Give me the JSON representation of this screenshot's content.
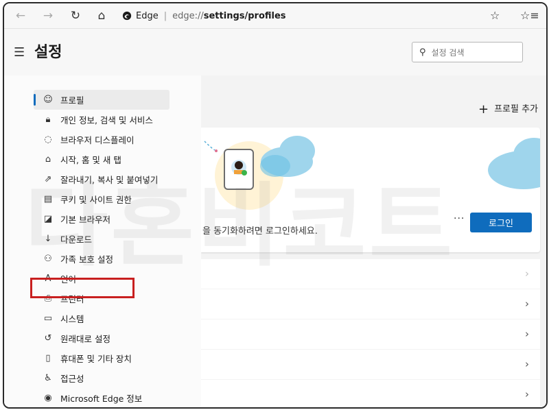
{
  "browser": {
    "brand": "Edge",
    "url_scheme": "edge://",
    "url_path": "settings/profiles"
  },
  "settings": {
    "title": "설정",
    "search_placeholder": "설정 검색"
  },
  "sidebar": {
    "items": [
      {
        "label": "프로필",
        "icon": "profile-icon",
        "glyph": "☺",
        "active": true
      },
      {
        "label": "개인 정보, 검색 및 서비스",
        "icon": "lock-icon",
        "glyph": "🔒︎"
      },
      {
        "label": "브라우저 디스플레이",
        "icon": "appearance-icon",
        "glyph": "◌"
      },
      {
        "label": "시작, 홈 및 새 탭",
        "icon": "home-tab-icon",
        "glyph": "⌂"
      },
      {
        "label": "잘라내기, 복사 및 붙여넣기",
        "icon": "share-icon",
        "glyph": "⇗"
      },
      {
        "label": "쿠키 및 사이트 권한",
        "icon": "site-permissions-icon",
        "glyph": "▤"
      },
      {
        "label": "기본 브라우저",
        "icon": "default-browser-icon",
        "glyph": "◪"
      },
      {
        "label": "다운로드",
        "icon": "download-icon",
        "glyph": "↓"
      },
      {
        "label": "가족 보호 설정",
        "icon": "family-icon",
        "glyph": "⚇"
      },
      {
        "label": "언어",
        "icon": "language-icon",
        "glyph": "A"
      },
      {
        "label": "프린터",
        "icon": "printer-icon",
        "glyph": "⎙"
      },
      {
        "label": "시스템",
        "icon": "system-icon",
        "glyph": "▭"
      },
      {
        "label": "원래대로 설정",
        "icon": "reset-icon",
        "glyph": "↺"
      },
      {
        "label": "휴대폰 및 기타 장치",
        "icon": "phone-icon",
        "glyph": "▯"
      },
      {
        "label": "접근성",
        "icon": "accessibility-icon",
        "glyph": "♿︎"
      },
      {
        "label": "Microsoft Edge 정보",
        "icon": "edge-logo-icon",
        "glyph": "◉"
      }
    ]
  },
  "main": {
    "add_profile_label": "프로필 추가",
    "sync_text": "을 동기화하려면 로그인하세요.",
    "more_label": "···",
    "login_button": "로그인"
  },
  "watermark": "다혼비코트",
  "colors": {
    "accent": "#0f6cbd",
    "highlight": "#c81f1f"
  }
}
